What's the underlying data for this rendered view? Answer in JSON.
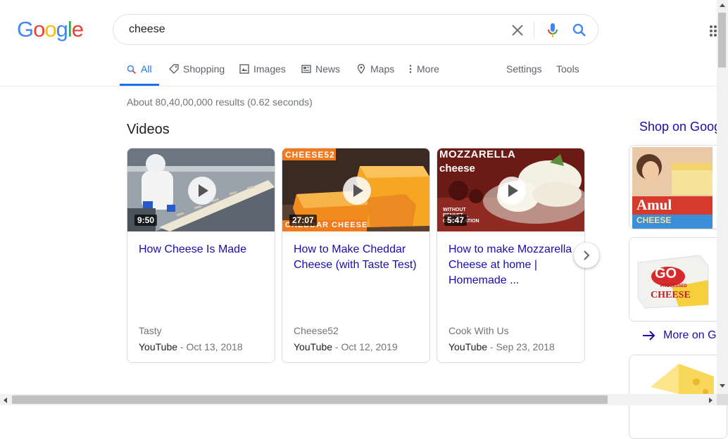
{
  "logo": {
    "letters": [
      "G",
      "o",
      "o",
      "g",
      "l",
      "e"
    ],
    "colors": [
      "#4285F4",
      "#EA4335",
      "#FBBC05",
      "#4285F4",
      "#34A853",
      "#EA4335"
    ]
  },
  "search": {
    "query": "cheese",
    "clear_icon": "close-icon",
    "mic_icon": "microphone-icon",
    "search_icon": "search-icon"
  },
  "tabs": [
    {
      "label": "All",
      "icon": "search-icon",
      "active": true
    },
    {
      "label": "Shopping",
      "icon": "tag-icon"
    },
    {
      "label": "Images",
      "icon": "image-icon"
    },
    {
      "label": "News",
      "icon": "newspaper-icon"
    },
    {
      "label": "Maps",
      "icon": "map-pin-icon"
    },
    {
      "label": "More",
      "icon": "vertical-dots-icon"
    }
  ],
  "settings_label": "Settings",
  "tools_label": "Tools",
  "result_stats": "About 80,40,00,000 results (0.62 seconds)",
  "videos_heading": "Videos",
  "videos": [
    {
      "title": "How Cheese Is Made",
      "duration": "9:50",
      "channel": "Tasty",
      "source": "YouTube",
      "date": "Oct 13, 2018"
    },
    {
      "title": "How to Make Cheddar Cheese (with Taste Test)",
      "duration": "27:07",
      "channel": "Cheese52",
      "source": "YouTube",
      "date": "Oct 12, 2019",
      "thumb_text_top": "CHEESE52",
      "thumb_text_bottom": "CHEDDAR CHEESE"
    },
    {
      "title": "How to make Mozzarella Cheese at home | Homemade ...",
      "duration": "5:47",
      "channel": "Cook With Us",
      "source": "YouTube",
      "date": "Sep 23, 2018",
      "thumb_text_top": "MOZZARELLA",
      "thumb_text_sub": "cheese",
      "thumb_text_small": "WITHOUT RENNET ... COAGULATION"
    }
  ],
  "date_separator": " - ",
  "shop": {
    "title": "Shop on Google",
    "more_label": "More on Google",
    "products": [
      {
        "brand_text": "Amul",
        "label_text": "CHEESE"
      },
      {
        "brand_text": "GO",
        "label_text": "CHEESE",
        "small_text": "PROCESSED"
      },
      {
        "image": "cheese-block"
      }
    ]
  },
  "colors": {
    "link": "#1a0dab",
    "accent": "#1a73e8",
    "muted": "#70757a"
  }
}
